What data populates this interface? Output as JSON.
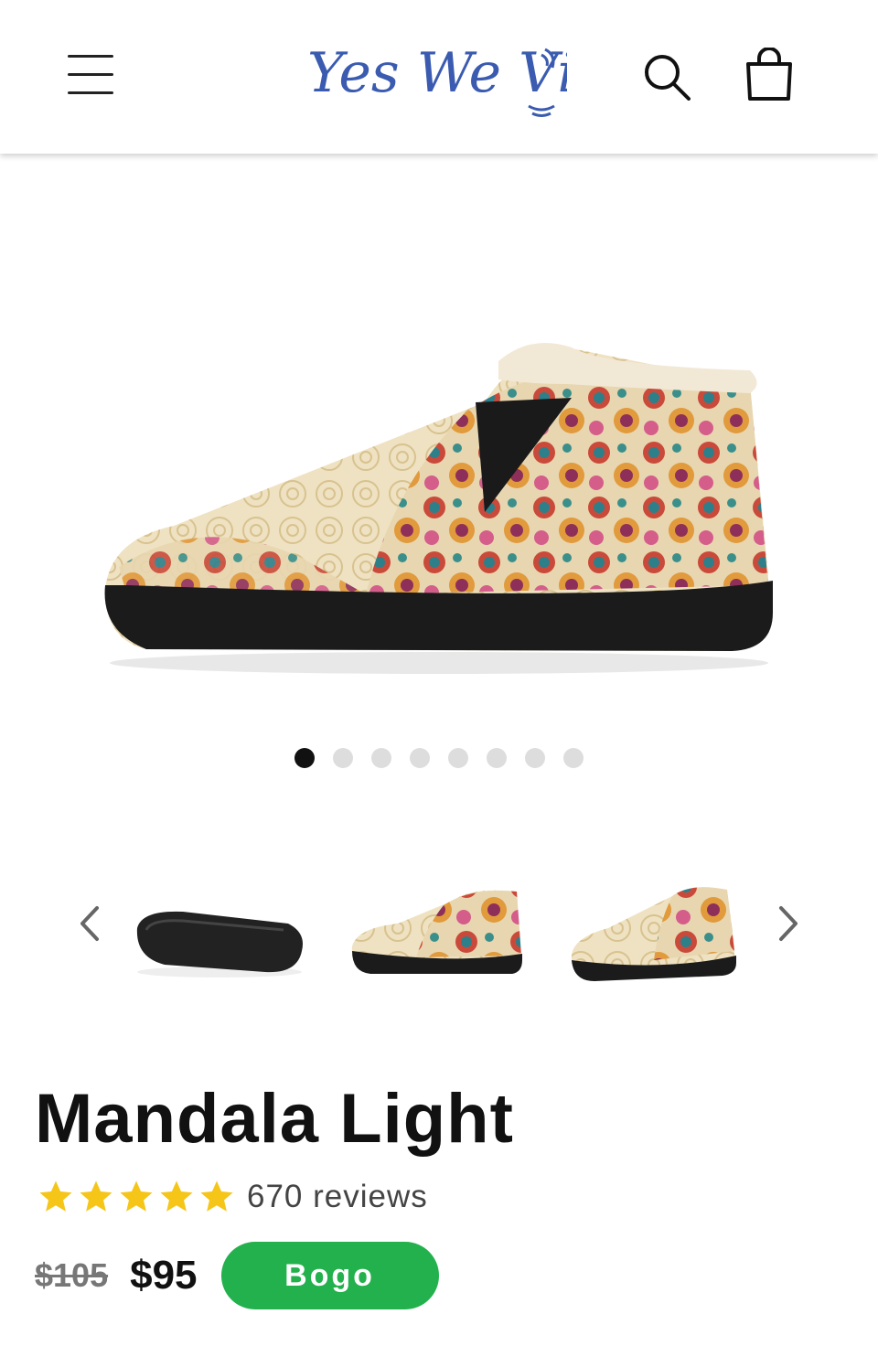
{
  "header": {
    "brand": "Yes We Vibe",
    "brand_color": "#3a5bb0",
    "menu_icon": "hamburger-icon",
    "search_icon": "search-icon",
    "cart_icon": "shopping-bag-icon"
  },
  "gallery": {
    "image_count": 8,
    "active_index": 0,
    "thumbnails": [
      "sole-bottom-view",
      "side-view",
      "three-quarter-view"
    ]
  },
  "product": {
    "title": "Mandala Light",
    "rating": 5,
    "reviews": "670 reviews",
    "old_price": "$105",
    "price": "$95",
    "badge": "Bogo",
    "badge_color": "#22b14c",
    "star_color": "#f5c518"
  }
}
